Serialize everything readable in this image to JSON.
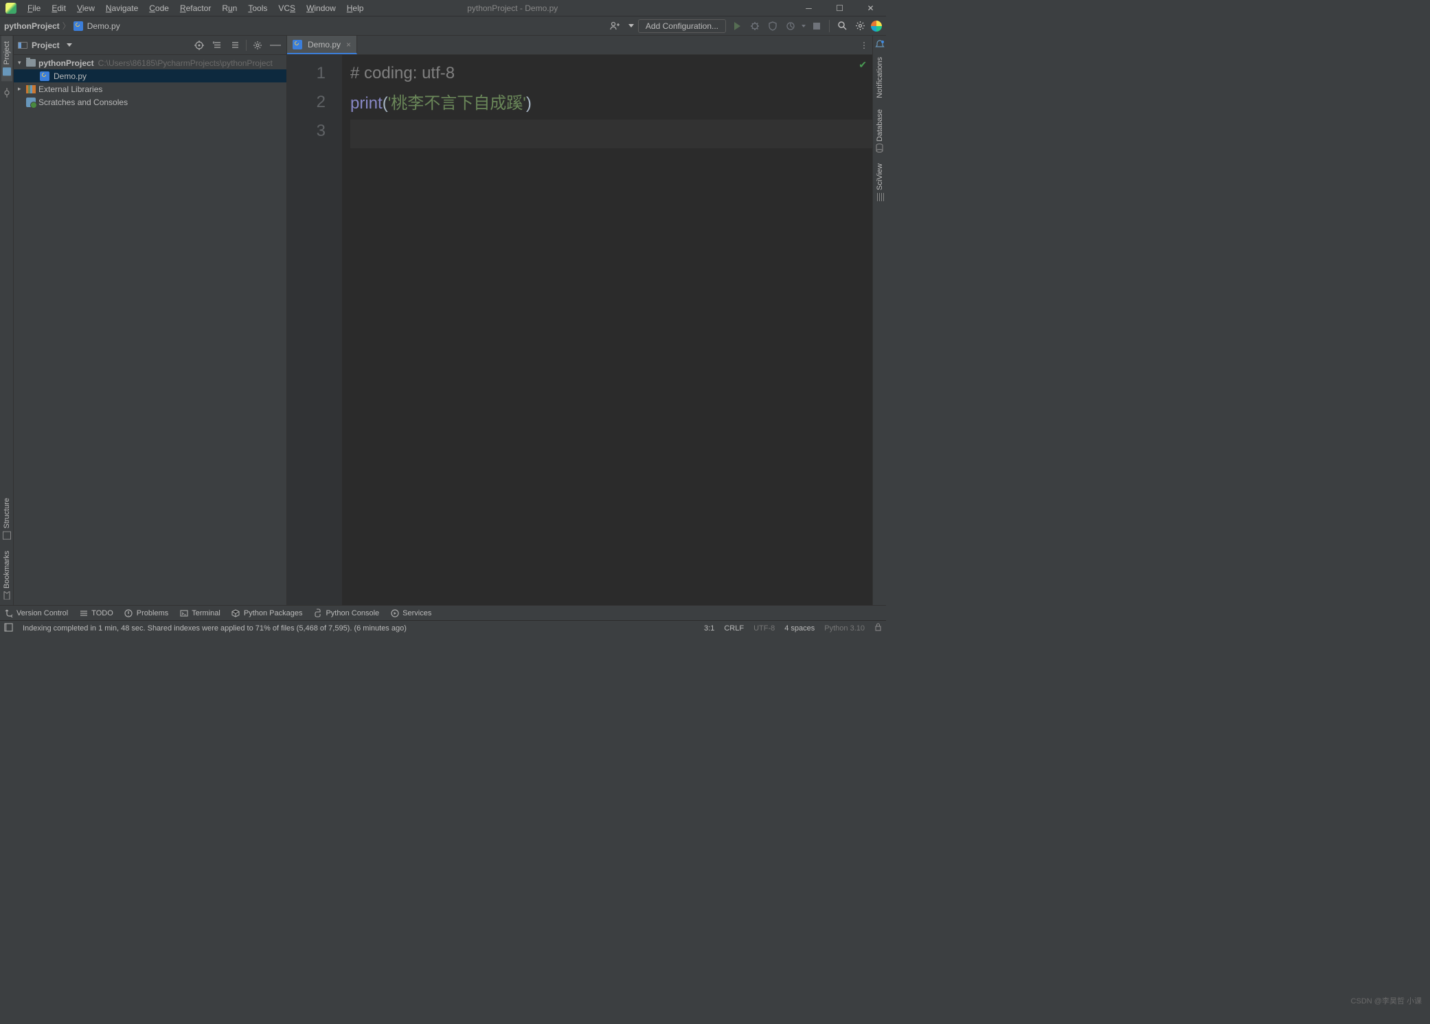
{
  "window": {
    "title": "pythonProject - Demo.py"
  },
  "menu": {
    "items": [
      "File",
      "Edit",
      "View",
      "Navigate",
      "Code",
      "Refactor",
      "Run",
      "Tools",
      "VCS",
      "Window",
      "Help"
    ]
  },
  "breadcrumb": {
    "project": "pythonProject",
    "file": "Demo.py"
  },
  "navbar": {
    "add_config": "Add Configuration..."
  },
  "project_panel": {
    "title": "Project",
    "root": {
      "name": "pythonProject",
      "path": "C:\\Users\\86185\\PycharmProjects\\pythonProject"
    },
    "file": "Demo.py",
    "external": "External Libraries",
    "scratches": "Scratches and Consoles"
  },
  "editor": {
    "tab": "Demo.py",
    "gutter": [
      "1",
      "2",
      "3"
    ],
    "line1": "# coding: utf-8",
    "line2_func": "print",
    "line2_open": "(",
    "line2_str": "'桃李不言下自成蹊'",
    "line2_close": ")"
  },
  "left_rail": {
    "project": "Project",
    "structure": "Structure",
    "bookmarks": "Bookmarks"
  },
  "right_rail": {
    "notifications": "Notifications",
    "database": "Database",
    "sciview": "SciView"
  },
  "toolwindows": {
    "vcs": "Version Control",
    "todo": "TODO",
    "problems": "Problems",
    "terminal": "Terminal",
    "packages": "Python Packages",
    "console": "Python Console",
    "services": "Services"
  },
  "status": {
    "msg": "Indexing completed in 1 min, 48 sec. Shared indexes were applied to 71% of files (5,468 of 7,595). (6 minutes ago)",
    "pos": "3:1",
    "eol": "CRLF",
    "enc": "UTF-8",
    "indent": "4 spaces",
    "interp": "Python 3.10"
  },
  "watermark": "CSDN @李昊哲 小课"
}
